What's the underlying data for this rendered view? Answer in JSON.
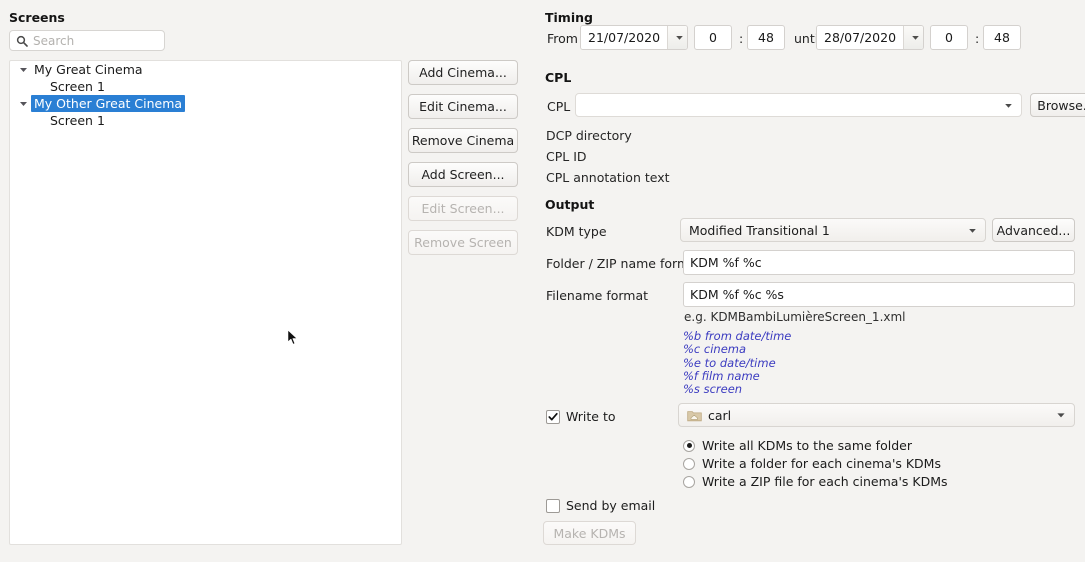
{
  "screens": {
    "title": "Screens",
    "search": {
      "placeholder": "Search",
      "value": "",
      "icon": "search-icon"
    },
    "tree": [
      {
        "label": "My Great Cinema",
        "level": 0,
        "expanded": true,
        "selected": false
      },
      {
        "label": "Screen 1",
        "level": 1,
        "expanded": false,
        "selected": false
      },
      {
        "label": "My Other Great Cinema",
        "level": 0,
        "expanded": true,
        "selected": true
      },
      {
        "label": "Screen 1",
        "level": 1,
        "expanded": false,
        "selected": false
      }
    ],
    "buttons": [
      {
        "label": "Add Cinema...",
        "enabled": true
      },
      {
        "label": "Edit Cinema...",
        "enabled": true
      },
      {
        "label": "Remove Cinema",
        "enabled": true
      },
      {
        "label": "Add Screen...",
        "enabled": true
      },
      {
        "label": "Edit Screen...",
        "enabled": false
      },
      {
        "label": "Remove Screen",
        "enabled": false
      }
    ]
  },
  "timing": {
    "title": "Timing",
    "from_label": "From",
    "from_date": "21/07/2020",
    "from_hour": "0",
    "from_sep": ":",
    "from_minute": "48",
    "until_label": "until",
    "until_date": "28/07/2020",
    "until_hour": "0",
    "until_sep": ":",
    "until_minute": "48"
  },
  "cpl": {
    "title": "CPL",
    "cpl_label": "CPL",
    "cpl_value": "",
    "browse_label": "Browse...",
    "dcp_directory_label": "DCP directory",
    "dcp_directory_value": "",
    "cpl_id_label": "CPL ID",
    "cpl_id_value": "",
    "cpl_annotation_label": "CPL annotation text",
    "cpl_annotation_value": ""
  },
  "output": {
    "title": "Output",
    "kdm_type_label": "KDM type",
    "kdm_type_value": "Modified Transitional 1",
    "advanced_label": "Advanced...",
    "folder_format_label": "Folder / ZIP name format",
    "folder_format_value": "KDM %f %c",
    "filename_format_label": "Filename format",
    "filename_format_value": "KDM %f %c %s",
    "example_text": "e.g. KDMBambiLumièreScreen_1.xml",
    "legend": [
      "%b from date/time",
      "%c cinema",
      "%e to date/time",
      "%f film name",
      "%s screen"
    ],
    "legend_color": "#3b3bc0",
    "write_to_label": "Write to",
    "write_to_checked": true,
    "write_to_folder": "carl",
    "write_to_folder_icon": "home-folder-icon",
    "radios": [
      {
        "label": "Write all KDMs to the same folder",
        "checked": true
      },
      {
        "label": "Write a folder for each cinema's KDMs",
        "checked": false
      },
      {
        "label": "Write a ZIP file for each cinema's KDMs",
        "checked": false
      }
    ],
    "send_by_email_label": "Send by email",
    "send_by_email_checked": false,
    "make_kdms_label": "Make KDMs",
    "make_kdms_enabled": false
  },
  "theme": {
    "background": "#f4f3f1",
    "selection": "#2a7fd4",
    "text": "#1a1a1a"
  }
}
